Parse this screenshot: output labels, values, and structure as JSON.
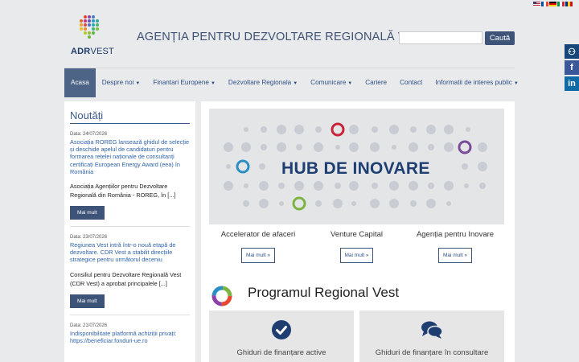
{
  "languages": [
    "English",
    "Français",
    "Deutsch",
    "Italiano",
    "Română"
  ],
  "header": {
    "logo_text_bold": "ADR",
    "logo_text_regular": "VEST",
    "site_title": "AGENȚIA PENTRU DEZVOLTARE REGIONALĂ VEST",
    "search_placeholder": "",
    "search_button": "Caută"
  },
  "social": {
    "accessibility": "⚇",
    "facebook": "f",
    "linkedin": "in"
  },
  "nav": [
    {
      "label": "Acasa",
      "dropdown": false,
      "active": true
    },
    {
      "label": "Despre noi",
      "dropdown": true,
      "active": false
    },
    {
      "label": "Finantari Europene",
      "dropdown": true,
      "active": false
    },
    {
      "label": "Dezvoltare Regionala",
      "dropdown": true,
      "active": false
    },
    {
      "label": "Comunicare",
      "dropdown": true,
      "active": false
    },
    {
      "label": "Cariere",
      "dropdown": false,
      "active": false
    },
    {
      "label": "Contact",
      "dropdown": false,
      "active": false
    },
    {
      "label": "Informatii de interes public",
      "dropdown": true,
      "active": false
    }
  ],
  "sidebar": {
    "title": "Noutăți",
    "more_label": "Mai mult",
    "news": [
      {
        "date": "Data: 24/07/2026",
        "title": "Asociația ROREG lansează ghidul de selecție și deschide apelul de candidaturi pentru formarea rețelei naționale de consultanți certificați European Energy Award (eea) în România",
        "excerpt": "Asociația Agențiilor pentru Dezvoltare Regională din România - ROREG, în [...]"
      },
      {
        "date": "Data: 23/07/2026",
        "title": "Regiunea Vest intră într-o nouă etapă de dezvoltare. CDR Vest a stabilit direcțiile strategice pentru următorul deceniu",
        "excerpt": "Consiliul pentru Dezvoltare Regională Vest (CDR Vest) a aprobat principalele [...]"
      },
      {
        "date": "Data: 21/07/2026",
        "title": "Indisponibilitate platformă achiziții privați: https://beneficiar.fonduri-ue.ro",
        "excerpt": ""
      }
    ]
  },
  "main": {
    "hero_text": "HUB DE INOVARE",
    "cards": [
      {
        "title": "Accelerator de afaceri",
        "button": "Mai mult »"
      },
      {
        "title": "Venture Capital",
        "button": "Mai mult »"
      },
      {
        "title": "Agenția pentru Inovare",
        "button": "Mai mult »"
      }
    ],
    "program_title": "Programul Regional Vest",
    "boxes": [
      {
        "title": "Ghiduri de finanțare active",
        "icon": "check-circle-icon"
      },
      {
        "title": "Ghiduri de finanțare în consultare",
        "icon": "comments-icon"
      }
    ]
  },
  "colors": {
    "primary": "#3d5378",
    "link": "#2f63a8",
    "hero_text": "#1e3e72",
    "background": "#e9eaeb"
  }
}
